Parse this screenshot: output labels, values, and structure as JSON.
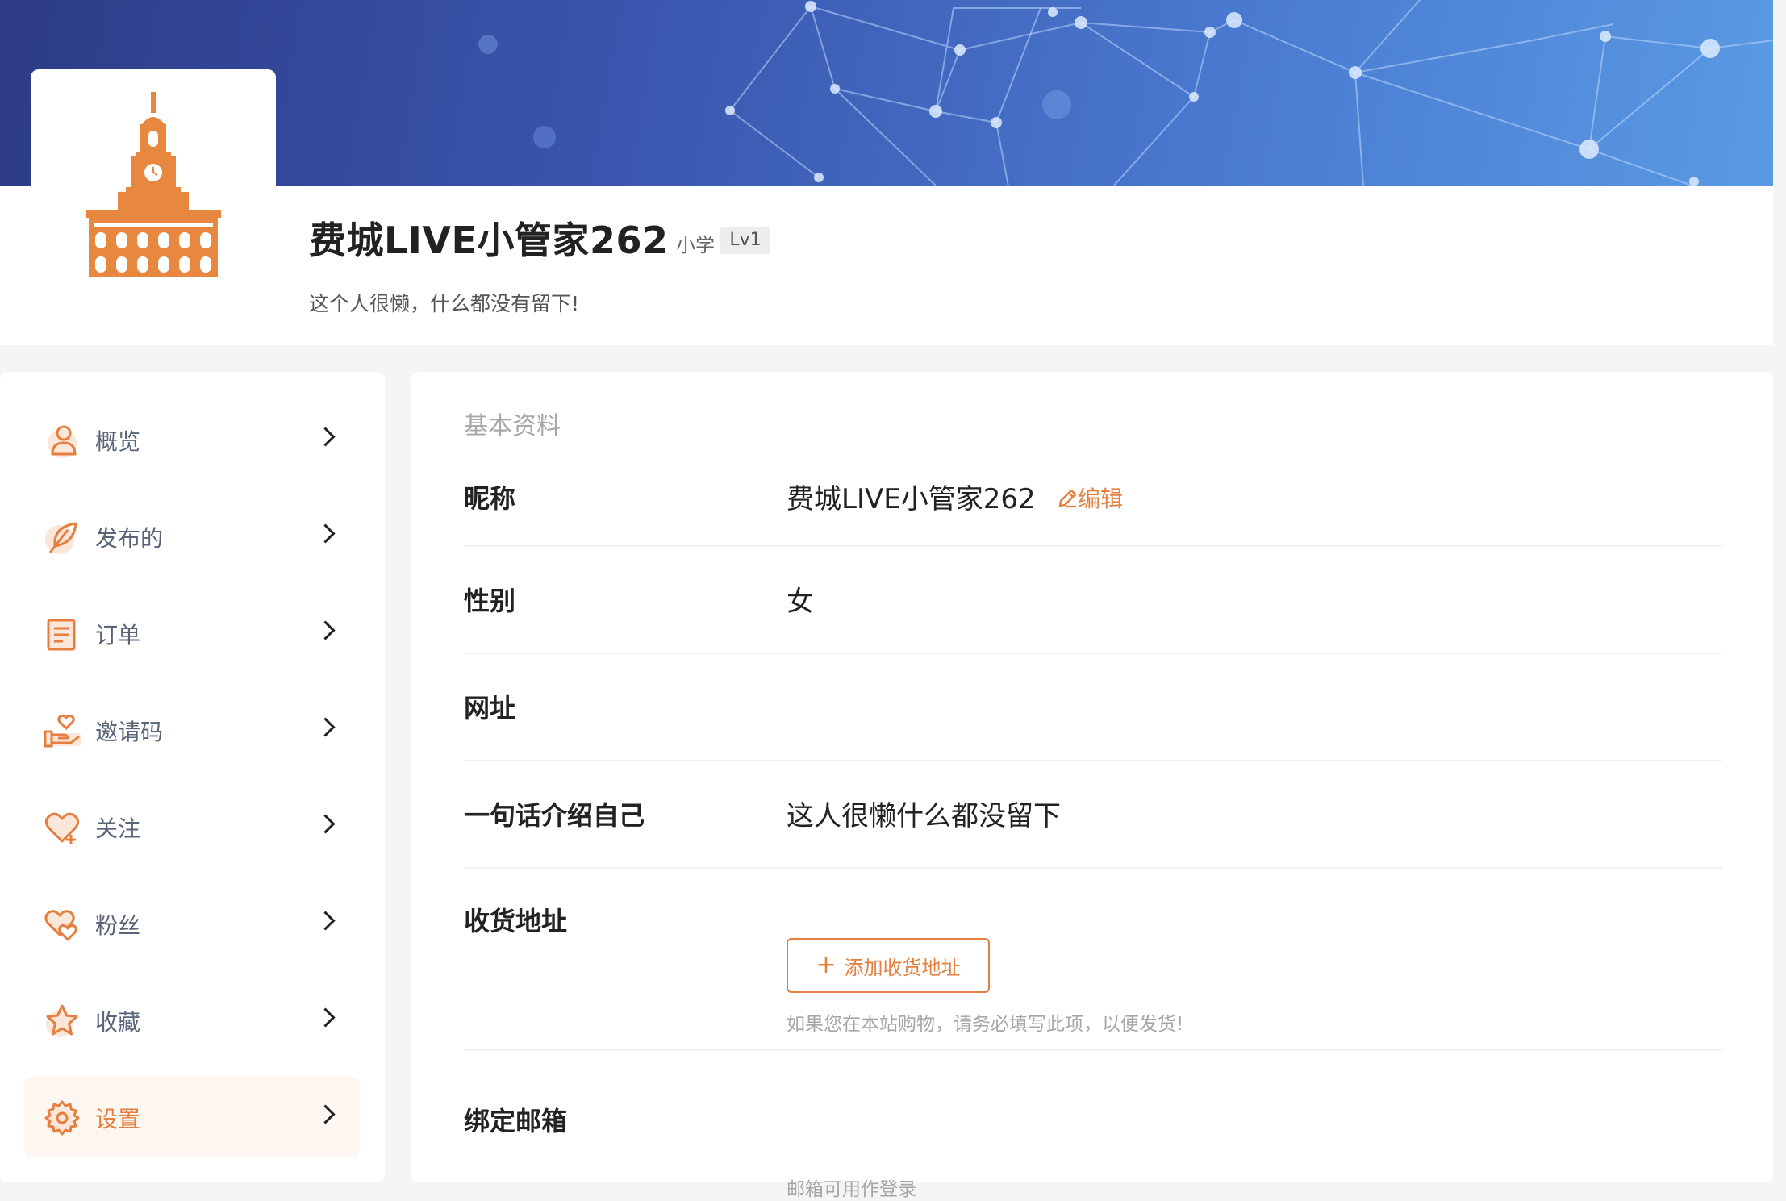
{
  "header": {
    "username": "费城LIVE小管家262",
    "grade": "小学",
    "level": "Lv1",
    "bio": "这个人很懒，什么都没有留下!"
  },
  "sidebar": {
    "items": [
      {
        "label": "概览",
        "icon": "user-icon"
      },
      {
        "label": "发布的",
        "icon": "feather-icon"
      },
      {
        "label": "订单",
        "icon": "document-icon"
      },
      {
        "label": "邀请码",
        "icon": "hand-heart-icon"
      },
      {
        "label": "关注",
        "icon": "heart-plus-icon"
      },
      {
        "label": "粉丝",
        "icon": "hearts-icon"
      },
      {
        "label": "收藏",
        "icon": "star-icon"
      },
      {
        "label": "设置",
        "icon": "gear-icon",
        "active": true
      }
    ]
  },
  "profile": {
    "section_title": "基本资料",
    "nickname_label": "昵称",
    "nickname_value": "费城LIVE小管家262",
    "edit_label": "编辑",
    "gender_label": "性别",
    "gender_value": "女",
    "website_label": "网址",
    "website_value": "",
    "intro_label": "一句话介绍自己",
    "intro_value": "这人很懒什么都没留下",
    "address_label": "收货地址",
    "add_address_button": "添加收货地址",
    "address_hint": "如果您在本站购物，请务必填写此项，以便发货!",
    "email_label": "绑定邮箱",
    "email_hint": "邮箱可用作登录"
  },
  "colors": {
    "accent": "#e57f3f",
    "banner_start": "#2d3b86",
    "banner_end": "#5a9ae3"
  }
}
